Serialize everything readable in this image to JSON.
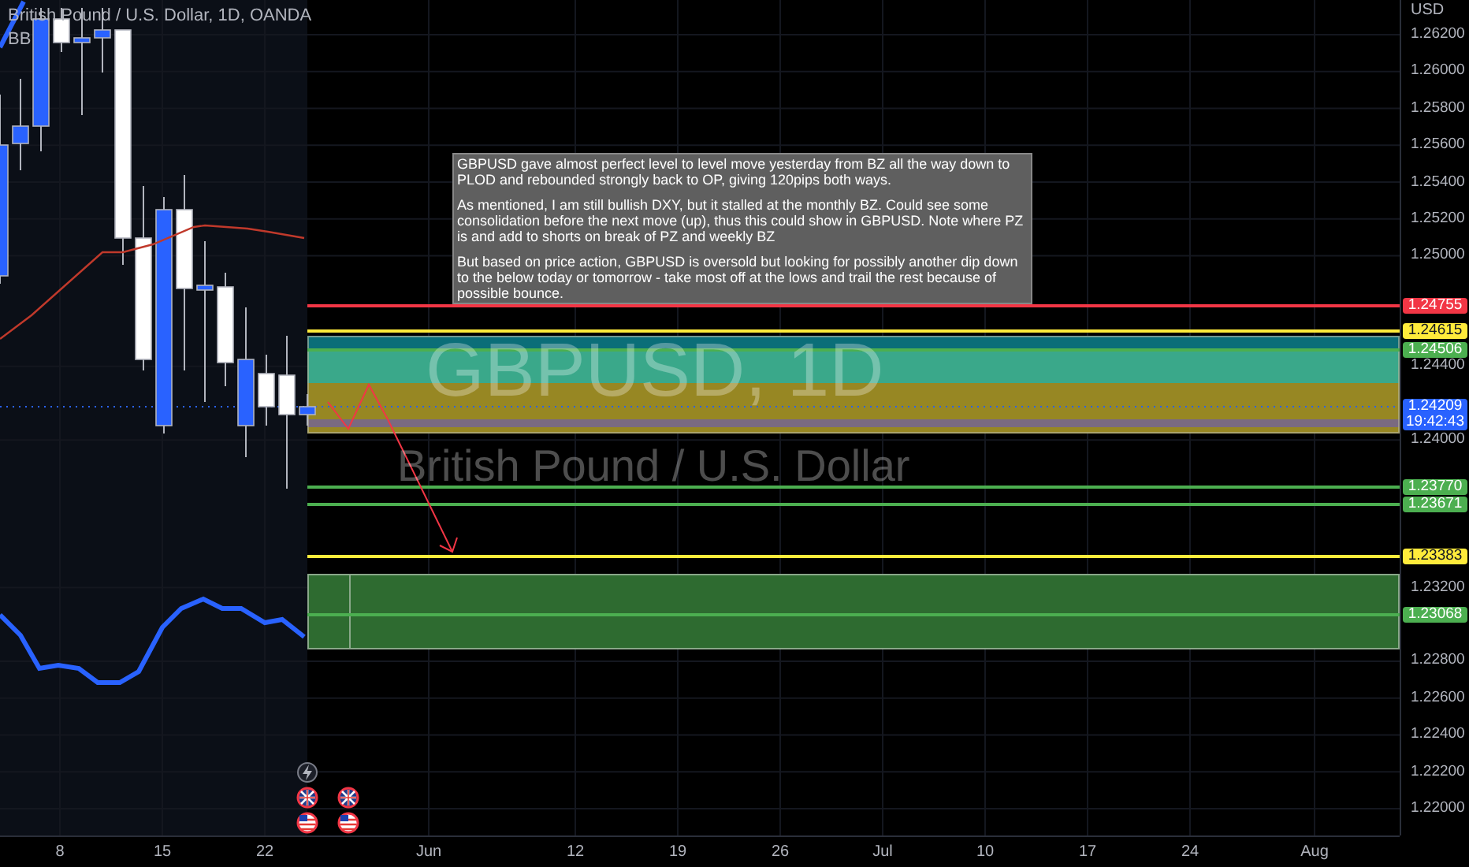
{
  "header": {
    "symbol": "British Pound / U.S. Dollar, 1D, OANDA",
    "indicator": "BB"
  },
  "watermark": {
    "ticker": "GBPUSD, 1D",
    "description": "British Pound / U.S. Dollar"
  },
  "note": {
    "paragraphs": [
      "GBPUSD gave almost perfect level to level move yesterday from BZ all the way down to PLOD and rebounded strongly back to OP, giving 120pips both ways.",
      "As mentioned, I am still bullish DXY, but it stalled at the monthly BZ. Could see some consolidation before the next move (up), thus this could show in GBPUSD. Note where PZ is and add to shorts on break of PZ and weekly BZ",
      "But based on price action, GBPUSD is oversold but looking for possibly another dip down to the below today or tomorrow - take most off at the lows and trail the rest because of possible bounce."
    ]
  },
  "price_axis": {
    "currency": "USD",
    "ticks": [
      "1.26200",
      "1.26000",
      "1.25800",
      "1.25600",
      "1.25400",
      "1.25200",
      "1.25000",
      "1.24400",
      "1.24000",
      "1.23200",
      "1.22800",
      "1.22600",
      "1.22400",
      "1.22200",
      "1.22000"
    ]
  },
  "price_labels": [
    {
      "kind": "line",
      "price": "1.24755",
      "color": "#f23645"
    },
    {
      "kind": "line",
      "price": "1.24615",
      "color": "#ffeb3b"
    },
    {
      "kind": "line",
      "price": "1.24506",
      "color": "#4caf50"
    },
    {
      "kind": "current",
      "price": "1.24209",
      "countdown": "19:42:43",
      "color": "#2962ff"
    },
    {
      "kind": "line",
      "price": "1.23770",
      "color": "#4caf50"
    },
    {
      "kind": "line",
      "price": "1.23671",
      "color": "#4caf50"
    },
    {
      "kind": "line",
      "price": "1.23383",
      "color": "#ffeb3b"
    },
    {
      "kind": "line",
      "price": "1.23068",
      "color": "#4caf50"
    }
  ],
  "time_axis": {
    "ticks": [
      "8",
      "15",
      "22",
      "Jun",
      "12",
      "19",
      "26",
      "Jul",
      "10",
      "17",
      "24",
      "Aug"
    ]
  }
}
